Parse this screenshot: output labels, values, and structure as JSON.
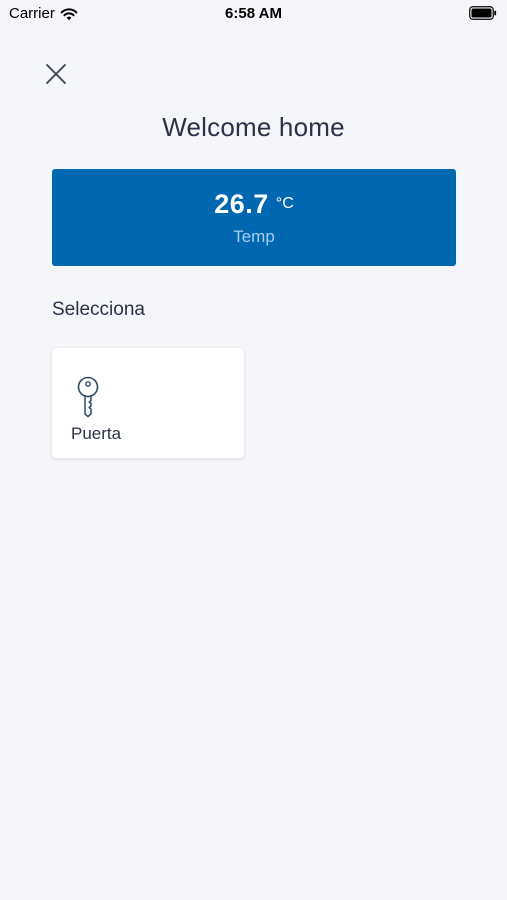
{
  "status_bar": {
    "carrier": "Carrier",
    "time": "6:58 AM"
  },
  "header": {
    "title": "Welcome home",
    "close_icon": "close-icon"
  },
  "temperature": {
    "value": "26.7",
    "unit": "°C",
    "label": "Temp",
    "card_color": "#0067b1"
  },
  "devices_section": {
    "heading": "Selecciona",
    "items": [
      {
        "label": "Puerta",
        "icon": "key-icon"
      }
    ]
  },
  "colors": {
    "background": "#f4f6f9",
    "accent": "#0067b1",
    "text": "#2b3247",
    "icon_stroke": "#2f4a6d"
  }
}
